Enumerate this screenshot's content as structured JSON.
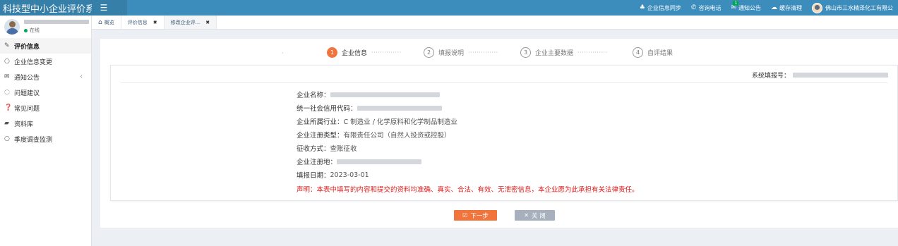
{
  "app": {
    "title": "科技型中小企业评价系统"
  },
  "topnav": [
    {
      "icon": "user-icon",
      "glyph": "♣",
      "label": "企业信息同步"
    },
    {
      "icon": "phone-icon",
      "glyph": "✆",
      "label": "咨询电话"
    },
    {
      "icon": "mail-icon",
      "glyph": "✉",
      "label": "通知公告",
      "badge": "1"
    },
    {
      "icon": "cloud-icon",
      "glyph": "☁",
      "label": "缓存清理"
    },
    {
      "icon": "avatar",
      "label": "佛山市三水精泽化工有限公"
    }
  ],
  "sidebar": {
    "status": "在线",
    "items": [
      {
        "name": "sidebar-item-evaluation-info",
        "icon": "edit-icon",
        "glyph": "✎",
        "label": "评价信息",
        "active": true
      },
      {
        "name": "sidebar-item-info-change",
        "icon": "circle-icon",
        "glyph": "○",
        "label": "企业信息变更"
      },
      {
        "name": "sidebar-item-notices",
        "icon": "envelope-icon",
        "glyph": "✉",
        "label": "通知公告",
        "caret": "‹"
      },
      {
        "name": "sidebar-item-suggestions",
        "icon": "comment-icon",
        "glyph": "◌",
        "label": "问题建议"
      },
      {
        "name": "sidebar-item-faq",
        "icon": "question-icon",
        "glyph": "❓",
        "label": "常见问题"
      },
      {
        "name": "sidebar-item-library",
        "icon": "folder-icon",
        "glyph": "▰",
        "label": "资料库"
      },
      {
        "name": "sidebar-item-quarterly-survey",
        "icon": "circle-icon",
        "glyph": "○",
        "label": "季度调查监测"
      }
    ]
  },
  "tabs": [
    {
      "label": "概览",
      "icon": "home-icon",
      "glyph": "⌂",
      "closable": false
    },
    {
      "label": "评价信息",
      "closable": true
    },
    {
      "label": "修改企业评...",
      "closable": true,
      "active": true
    }
  ],
  "steps": [
    {
      "num": "1",
      "label": "企业信息",
      "active": true
    },
    {
      "num": "2",
      "label": "填报说明"
    },
    {
      "num": "3",
      "label": "企业主要数据"
    },
    {
      "num": "4",
      "label": "自评结果"
    }
  ],
  "form": {
    "sysno_label": "系统填报号：",
    "fields": [
      {
        "label": "企业名称：",
        "value": "",
        "redacted": true
      },
      {
        "label": "统一社会信用代码：",
        "value": "",
        "redacted": true
      },
      {
        "label": "企业所属行业：",
        "value": "C 制造业 / 化学原料和化学制品制造业"
      },
      {
        "label": "企业注册类型：",
        "value": "有限责任公司（自然人投资或控股）"
      },
      {
        "label": "征收方式：",
        "value": "查账征收"
      },
      {
        "label": "企业注册地：",
        "value": "",
        "redacted": true
      },
      {
        "label": "填报日期：",
        "value": "2023-03-01"
      }
    ],
    "declaration": "声明：本表中填写的内容和提交的资料均准确、真实、合法、有效、无泄密信息，本企业愿为此承担有关法律责任。"
  },
  "buttons": {
    "next_label": "下一步",
    "next_icon": "☑",
    "close_label": "关 闭",
    "close_icon": "✕"
  },
  "colors": {
    "header": "#3c8dbc",
    "accent": "#f0743c",
    "warning": "#e01b1b",
    "close_button": "#a7b1bd"
  }
}
